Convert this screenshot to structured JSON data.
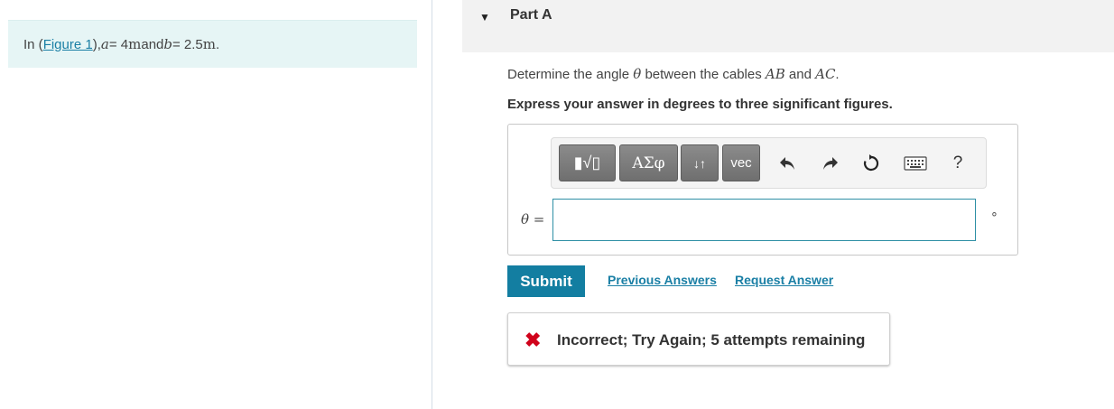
{
  "problem": {
    "prefix": "In (",
    "figure_link": "Figure 1",
    "suffix_open": "), ",
    "a_var": "a",
    "a_eq": " = 4 ",
    "a_unit": "m",
    "and_text": " and ",
    "b_var": "b",
    "b_eq": " = 2.5 ",
    "b_unit": "m",
    "period": "."
  },
  "part": {
    "caret_icon": "triangle-down",
    "title": "Part A"
  },
  "question": {
    "prefix": "Determine the angle ",
    "theta": "θ",
    "middle": " between the cables ",
    "ab": "AB",
    "and_text": " and ",
    "ac": "AC",
    "period": "."
  },
  "instruction": "Express your answer in degrees to three significant figures.",
  "toolbar": {
    "template_btn": "▮√▯",
    "greek_btn": "ΑΣφ",
    "arrows_btn": "↓↑",
    "vec_btn": "vec",
    "help_label": "?"
  },
  "answer": {
    "label": "θ =",
    "value": "",
    "unit": "∘"
  },
  "actions": {
    "submit": "Submit",
    "previous_answers": "Previous Answers",
    "request_answer": "Request Answer"
  },
  "feedback": {
    "icon": "✖",
    "message": "Incorrect; Try Again; 5 attempts remaining",
    "color": "#d0021b"
  }
}
